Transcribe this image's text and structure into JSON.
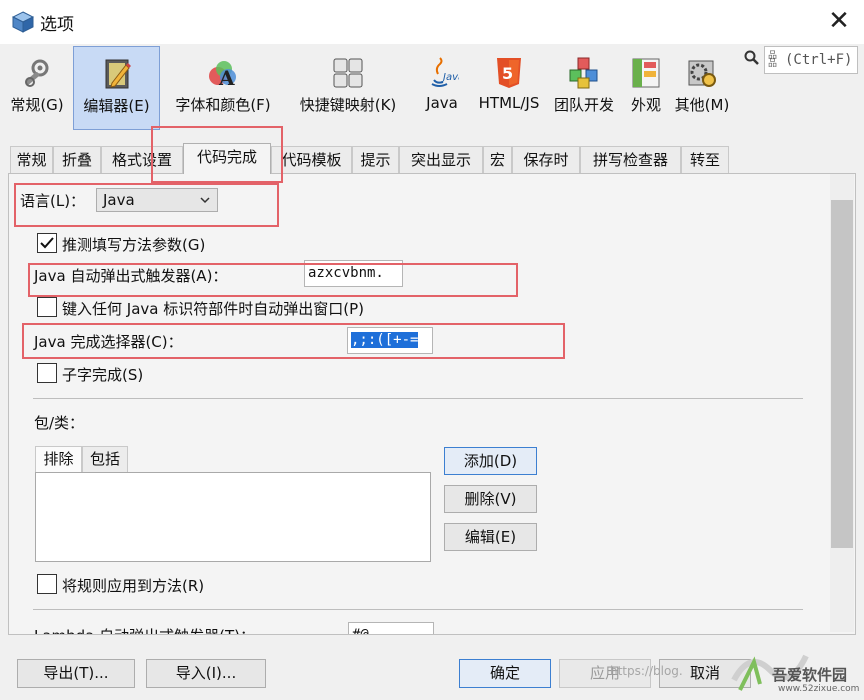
{
  "window": {
    "title": "选项",
    "close_glyph": "✕"
  },
  "categories": [
    {
      "label": "常规(G)",
      "icon": "wrench-gear-icon"
    },
    {
      "label": "编辑器(E)",
      "icon": "editor-pencil-icon",
      "selected": true
    },
    {
      "label": "字体和颜色(F)",
      "icon": "font-color-icon"
    },
    {
      "label": "快捷键映射(K)",
      "icon": "keyboard-icon"
    },
    {
      "label": "Java",
      "icon": "java-logo-icon"
    },
    {
      "label": "HTML/JS",
      "icon": "html5-icon"
    },
    {
      "label": "团队开发",
      "icon": "team-cubes-icon"
    },
    {
      "label": "外观",
      "icon": "appearance-icon"
    },
    {
      "label": "其他(M)",
      "icon": "misc-gears-icon"
    }
  ],
  "search": {
    "placeholder": "(Ctrl+F)",
    "glyph": "品\n品",
    "icon": "search-icon"
  },
  "tabs": [
    {
      "label": "常规"
    },
    {
      "label": "折叠"
    },
    {
      "label": "格式设置"
    },
    {
      "label": "代码完成",
      "active": true
    },
    {
      "label": "代码模板"
    },
    {
      "label": "提示"
    },
    {
      "label": "突出显示"
    },
    {
      "label": "宏"
    },
    {
      "label": "保存时"
    },
    {
      "label": "拼写检查器"
    },
    {
      "label": "转至"
    }
  ],
  "form": {
    "language_label": "语言(L)：",
    "language_value": "Java",
    "guess_params_label": "推测填写方法参数(G)",
    "guess_params_checked": true,
    "auto_popup_label": "Java 自动弹出式触发器(A)：",
    "auto_popup_value": "azxcvbnm.",
    "identifier_popup_label": "键入任何 Java 标识符部件时自动弹出窗口(P)",
    "identifier_popup_checked": false,
    "selectors_label": "Java 完成选择器(C)：",
    "selectors_value": ",;:([+-=",
    "subword_label": "子字完成(S)",
    "subword_checked": false,
    "packages_label": "包/类：",
    "subtabs": [
      {
        "label": "排除",
        "active": true
      },
      {
        "label": "包括"
      }
    ],
    "add_button": "添加(D)",
    "remove_button": "删除(V)",
    "edit_button": "编辑(E)",
    "apply_rule_label": "将规则应用到方法(R)",
    "apply_rule_checked": false,
    "lambda_label": "Lambda 自动弹出式触发器(T)：",
    "lambda_value": "#@"
  },
  "footer": {
    "export_button": "导出(T)...",
    "import_button": "导入(I)...",
    "ok_button": "确定",
    "apply_button": "应用",
    "cancel_button": "取消"
  },
  "watermark": {
    "url_text": "https://blog.",
    "site_name": "吾爱软件园",
    "site_url": "www.52zixue.com"
  },
  "colors": {
    "selection": "#1e6fd9",
    "highlight_box": "#e36268",
    "selected_category": "#c8daf5"
  }
}
